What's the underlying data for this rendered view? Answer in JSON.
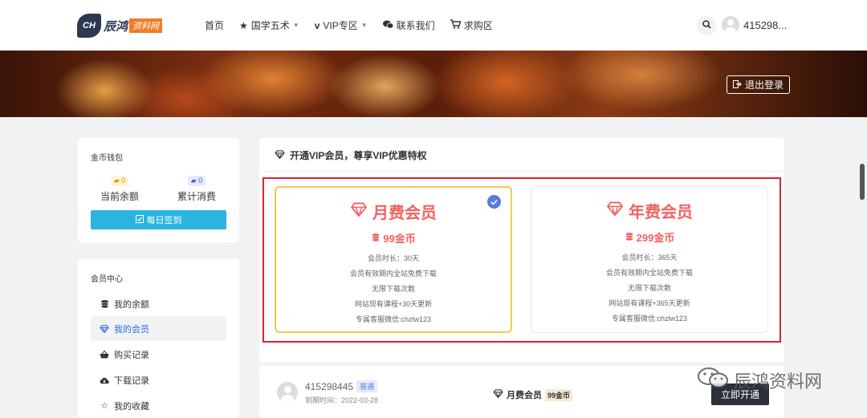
{
  "logo": {
    "badge": "CH",
    "text": "辰鸿",
    "tag": "资料网"
  },
  "nav": [
    {
      "label": "首页",
      "icon": "",
      "caret": false
    },
    {
      "label": "国学五术",
      "icon": "star-icon",
      "caret": true
    },
    {
      "label": "VIP专区",
      "icon": "vip-icon",
      "caret": true
    },
    {
      "label": "联系我们",
      "icon": "wechat-icon",
      "caret": false
    },
    {
      "label": "求购区",
      "icon": "cart-icon",
      "caret": false
    }
  ],
  "user": {
    "name": "415298..."
  },
  "banner": {
    "logout": "退出登录"
  },
  "wallet": {
    "title": "金币钱包",
    "balance_value": "0",
    "balance_label": "当前余额",
    "spent_value": "0",
    "spent_label": "累计消费",
    "checkin": "每日签到"
  },
  "member_center": {
    "title": "会员中心",
    "items": [
      {
        "label": "我的余额",
        "icon": "coins-icon"
      },
      {
        "label": "我的会员",
        "icon": "diamond-icon"
      },
      {
        "label": "购买记录",
        "icon": "basket-icon"
      },
      {
        "label": "下载记录",
        "icon": "cloud-download-icon"
      },
      {
        "label": "我的收藏",
        "icon": "star-outline-icon"
      }
    ]
  },
  "main": {
    "heading": "开通VIP会员，尊享VIP优惠特权"
  },
  "plans": [
    {
      "name": "月费会员",
      "price": "99金币",
      "selected": true,
      "lines": [
        "会员时长：30天",
        "会员有效期内全站免费下载",
        "无限下载次数",
        "网站现有课程+30天更新",
        "专属客服微信:chzlw123"
      ]
    },
    {
      "name": "年费会员",
      "price": "299金币",
      "selected": false,
      "lines": [
        "会员时长：365天",
        "会员有效期内全站免费下载",
        "无限下载次数",
        "网站现有课程+365天更新",
        "专属客服微信:chzlw123"
      ]
    }
  ],
  "subscription": {
    "username": "415298445",
    "level": "普通",
    "expire": "到期时间：2022-03-28",
    "plan": "月费会员",
    "price": "99金币",
    "button": "立即开通"
  },
  "watermark": "辰鸿资料网",
  "colors": {
    "accent_red": "#f36160",
    "selected_border": "#f5c84a",
    "highlight_box": "#e0212f",
    "checkin_blue": "#2ab5e0"
  }
}
